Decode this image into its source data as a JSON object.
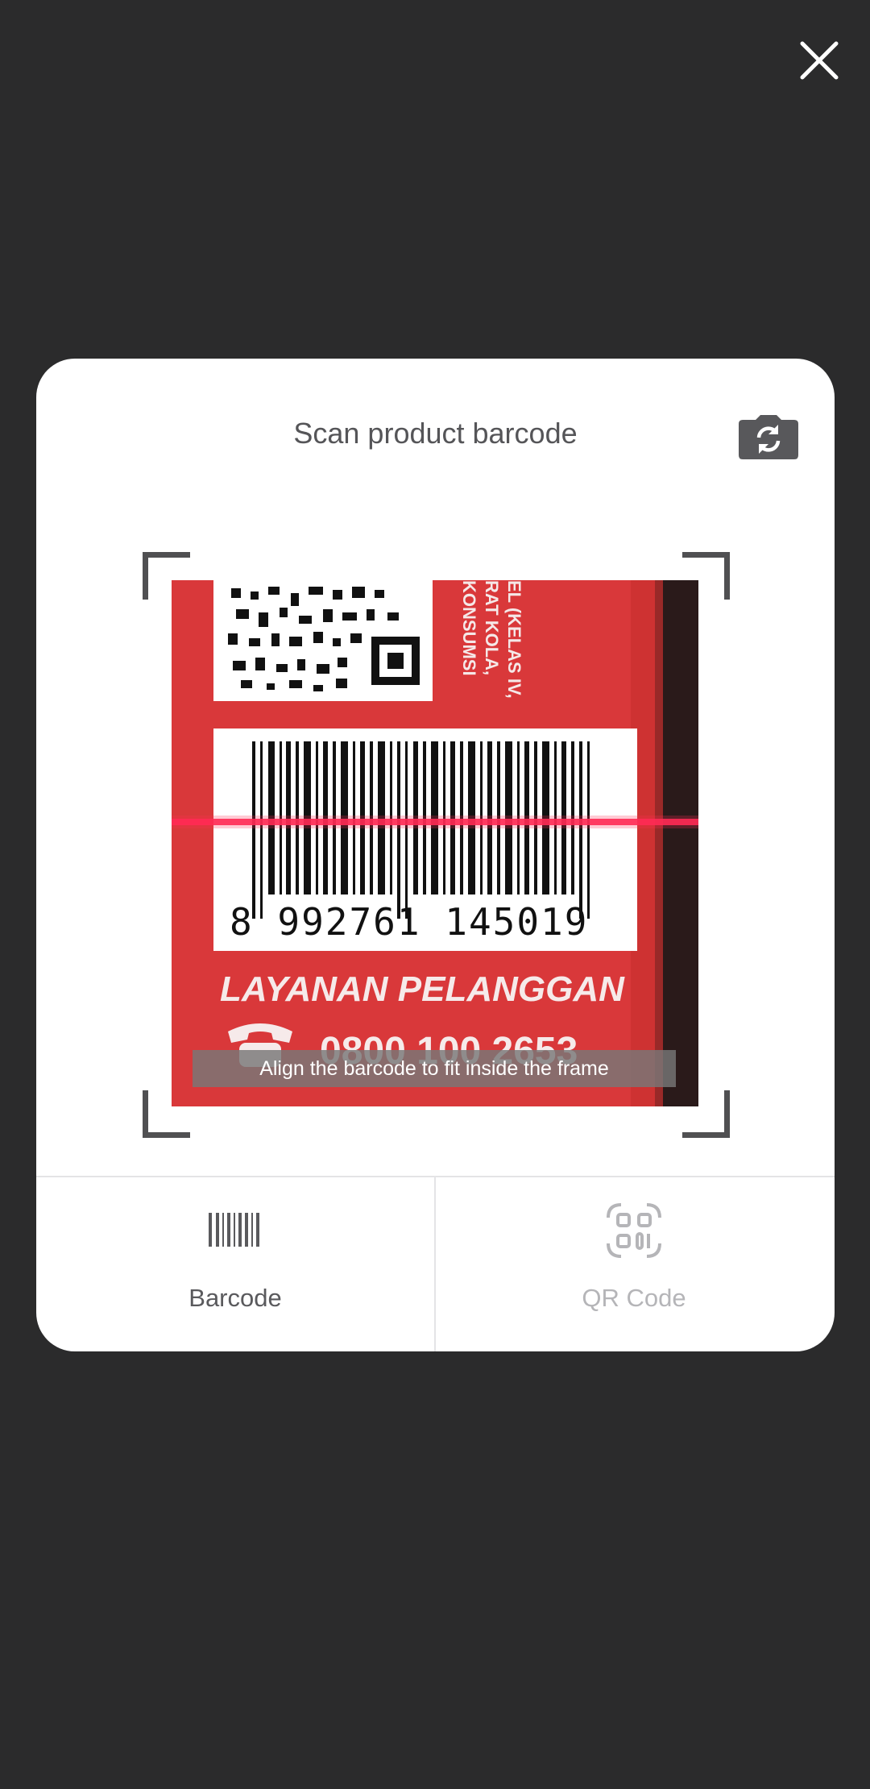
{
  "window": {
    "close_icon": "close-icon"
  },
  "sheet": {
    "title": "Scan product barcode",
    "camera_switch_icon": "camera-switch-icon"
  },
  "scanner": {
    "hint": "Align the barcode to fit inside the frame",
    "preview": {
      "barcode_number": "8 992761 145019",
      "label_line_1": "LAYANAN PELANGGAN",
      "label_line_2": "0800 100 2653",
      "side_text_1": "EL (KELAS IV,",
      "side_text_2": "RAT KOLA,",
      "side_text_3": "KONSUMSI",
      "background_color": "#d9383a",
      "scan_line_color": "#ff2a55"
    }
  },
  "tabs": {
    "barcode_label": "Barcode",
    "barcode_icon": "barcode-icon",
    "qr_label": "QR Code",
    "qr_icon": "qr-code-icon",
    "active": "Barcode"
  }
}
